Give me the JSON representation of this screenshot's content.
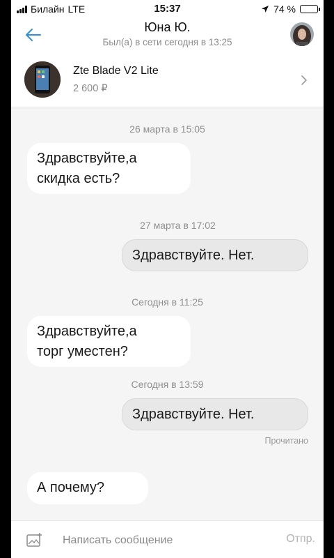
{
  "status": {
    "carrier": "Билайн",
    "network": "LTE",
    "time": "15:37",
    "battery": "74 %",
    "battery_level": 0.74
  },
  "header": {
    "title": "Юна Ю.",
    "subtitle": "Был(а) в сети сегодня в 13:25"
  },
  "product": {
    "name": "Zte Blade V2 Lite",
    "price": "2 600 ₽"
  },
  "messages": [
    {
      "date": "26 марта в 15:05",
      "text_lines": [
        "Здравствуйте,а",
        "скидка есть?"
      ],
      "direction": "in"
    },
    {
      "date": "27 марта в 17:02",
      "text_lines": [
        "Здравствуйте. Нет."
      ],
      "direction": "out"
    },
    {
      "date": "Сегодня в 11:25",
      "text_lines": [
        "Здравствуйте,а",
        "торг уместен?"
      ],
      "direction": "in"
    },
    {
      "date": "Сегодня в 13:59",
      "text_lines": [
        "Здравствуйте. Нет."
      ],
      "direction": "out",
      "status": "Прочитано"
    },
    {
      "text_lines": [
        "А почему?"
      ],
      "direction": "in"
    }
  ],
  "composer": {
    "placeholder": "Написать сообщение",
    "send_label": "Отпр."
  },
  "colors": {
    "accent": "#2f8fdc",
    "background": "#f5f5f5",
    "incoming_bubble": "#ffffff",
    "outgoing_bubble": "#e8e8e8"
  },
  "icons": [
    "signal-icon",
    "location-arrow-icon",
    "battery-icon",
    "back-arrow-icon",
    "chevron-right-icon",
    "attach-image-icon"
  ]
}
